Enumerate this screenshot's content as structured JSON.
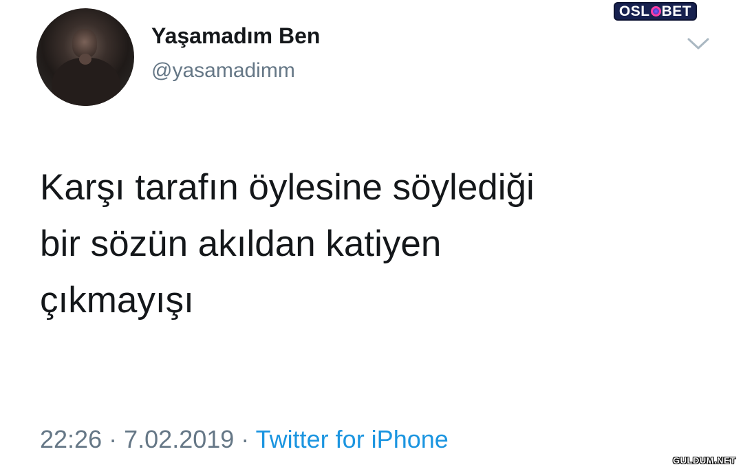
{
  "user": {
    "display_name": "Yaşamadım Ben",
    "handle": "@yasamadimm"
  },
  "tweet": {
    "lines": [
      "Karşı tarafın öylesine söylediği",
      "bir sözün akıldan katiyen",
      "çıkmayışı"
    ],
    "time": "22:26",
    "date": "7.02.2019",
    "separator": "·",
    "source": "Twitter for iPhone"
  },
  "overlays": {
    "top_logo": "OSLOBET",
    "bottom_watermark": "GULDUM.NET"
  },
  "icons": {
    "menu": "chevron-down-icon"
  },
  "colors": {
    "text": "#14171a",
    "secondary": "#657786",
    "link": "#1b95e0",
    "logo_bg": "#17214f"
  }
}
